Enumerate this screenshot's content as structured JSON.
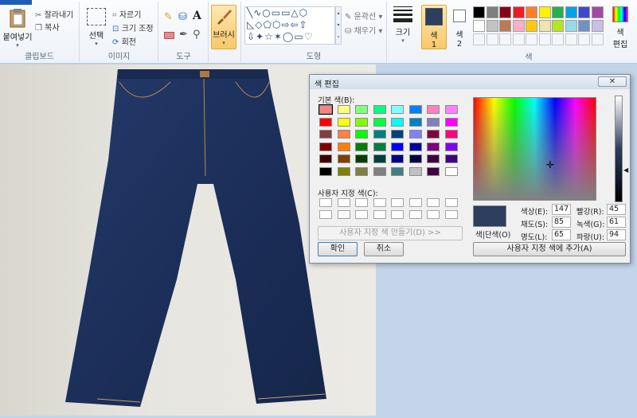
{
  "ribbon": {
    "paste_label": "붙여넣기",
    "cut_label": "잘라내기",
    "copy_label": "복사",
    "clipboard_group": "클립보드",
    "select_label": "선택",
    "crop_label": "자르기",
    "resize_label": "크기 조정",
    "rotate_label": "회전",
    "image_group": "이미지",
    "tools_group": "도구",
    "brush_label": "브러시",
    "outline_label": "윤곽선",
    "fill_label": "채우기",
    "shapes_group": "도형",
    "size_label": "크기",
    "color1_label": "색",
    "color1_num": "1",
    "color2_label": "색",
    "color2_num": "2",
    "edit_colors_label": "색",
    "edit_colors_label2": "편집",
    "colors_group": "색",
    "color1_value": "#2d3d5e",
    "color2_value": "#ffffff",
    "palette_row1": [
      "#000000",
      "#7f7f7f",
      "#880015",
      "#ed1c24",
      "#ff7f27",
      "#fff200",
      "#22b14c",
      "#00a2e8",
      "#3f48cc",
      "#a349a4"
    ],
    "palette_row2": [
      "#ffffff",
      "#c3c3c3",
      "#b97a57",
      "#ffaec9",
      "#ffc90e",
      "#efe4b0",
      "#b5e61d",
      "#99d9ea",
      "#7092be",
      "#c8bfe7"
    ]
  },
  "dialog": {
    "title": "색 편집",
    "close_glyph": "✕",
    "basic_colors_label": "기본 색(B):",
    "basic_colors": [
      [
        "#ff8080",
        "#ffff80",
        "#80ff80",
        "#00ff80",
        "#80ffff",
        "#0080ff",
        "#ff80c0",
        "#ff80ff"
      ],
      [
        "#ff0000",
        "#ffff00",
        "#80ff00",
        "#00ff40",
        "#00ffff",
        "#0080c0",
        "#8080c0",
        "#ff00ff"
      ],
      [
        "#804040",
        "#ff8040",
        "#00ff00",
        "#008080",
        "#004080",
        "#8080ff",
        "#800040",
        "#ff0080"
      ],
      [
        "#800000",
        "#ff8000",
        "#008000",
        "#008040",
        "#0000ff",
        "#0000a0",
        "#800080",
        "#8000ff"
      ],
      [
        "#400000",
        "#804000",
        "#004000",
        "#004040",
        "#000080",
        "#000040",
        "#400040",
        "#400080"
      ],
      [
        "#000000",
        "#808000",
        "#808040",
        "#808080",
        "#408080",
        "#c0c0c0",
        "#400040",
        "#ffffff"
      ]
    ],
    "custom_colors_label": "사용자 지정 색(C):",
    "define_custom_label": "사용자 지정 색 만들기(D) >>",
    "ok_label": "확인",
    "cancel_label": "취소",
    "solid_label": "색|단색(O)",
    "add_custom_label": "사용자 지정 색에 추가(A)",
    "hue_label": "색상(E):",
    "hue_value": "147",
    "sat_label": "채도(S):",
    "sat_value": "85",
    "lum_label": "명도(L):",
    "lum_value": "65",
    "red_label": "빨강(R):",
    "red_value": "45",
    "green_label": "녹색(G):",
    "green_value": "61",
    "blue_label": "파랑(U):",
    "blue_value": "94",
    "current_color": "#2d3d5e"
  }
}
